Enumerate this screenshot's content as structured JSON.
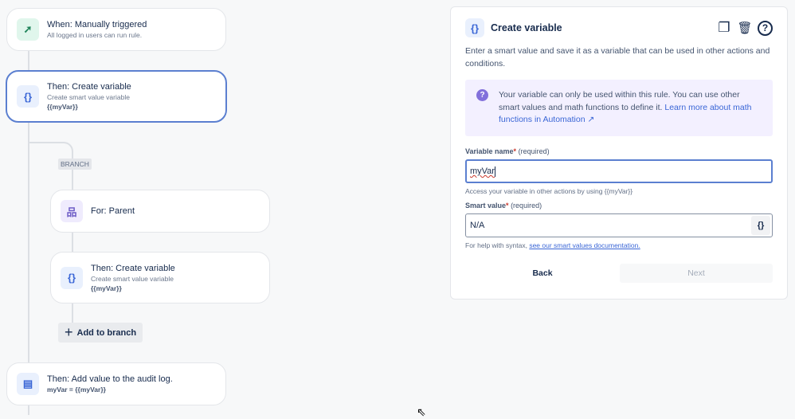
{
  "flow": {
    "trigger": {
      "title": "When: Manually triggered",
      "subtitle": "All logged in users can run rule.",
      "icon": "cursor-click-icon"
    },
    "create_var": {
      "title": "Then: Create variable",
      "subtitle": "Create smart value variable",
      "value": "{{myVar}}",
      "icon": "{}"
    },
    "branch_label": "BRANCH",
    "for_parent": {
      "title": "For: Parent",
      "icon": "hierarchy-icon"
    },
    "branch_create_var": {
      "title": "Then: Create variable",
      "subtitle": "Create smart value variable",
      "value": "{{myVar}}",
      "icon": "{}"
    },
    "add_to_branch": {
      "plus": "+",
      "label": "Add to branch"
    },
    "audit_log": {
      "title": "Then: Add value to the audit log.",
      "value": "myVar = {{myVar}}",
      "icon": "document-icon"
    }
  },
  "panel": {
    "icon": "{}",
    "title": "Create variable",
    "description": "Enter a smart value and save it as a variable that can be used in other actions and conditions.",
    "info_text": "Your variable can only be used within this rule. You can use other smart values and math functions to define it. ",
    "info_link": "Learn more about math functions in Automation ↗",
    "info_icon": "?",
    "variable_name": {
      "label": "Variable name",
      "star": "*",
      "required": "(required)",
      "value": "myVar",
      "help": "Access your variable in other actions by using {{myVar}}"
    },
    "smart_value": {
      "label": "Smart value",
      "star": "*",
      "required": "(required)",
      "value": "N/A",
      "brace": "{}",
      "help_prefix": "For help with syntax, ",
      "help_link": "see our smart values documentation."
    },
    "back_label": "Back",
    "next_label": "Next",
    "header_icons": {
      "duplicate": "❐",
      "delete": "🗑",
      "help": "?"
    }
  },
  "colors": {
    "accent": "#5b7fd0",
    "info_bg": "#f3f0ff",
    "info_icon": "#8270db"
  }
}
